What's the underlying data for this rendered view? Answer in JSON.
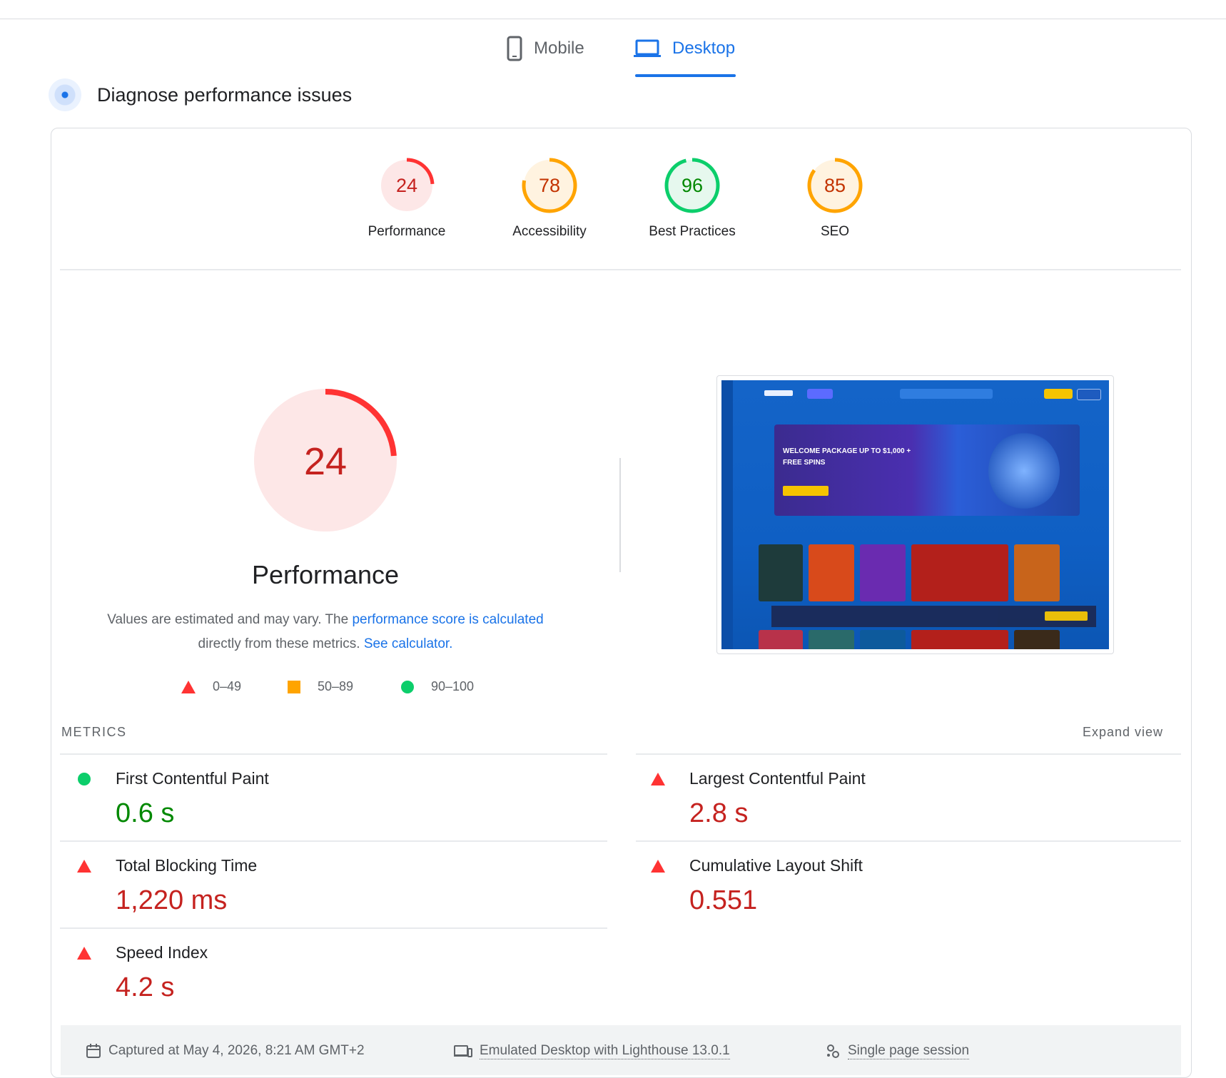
{
  "tabs": {
    "mobile": "Mobile",
    "desktop": "Desktop"
  },
  "diagnose_title": "Diagnose performance issues",
  "scores": [
    {
      "label": "Performance",
      "value": "24",
      "score": 24,
      "status": "fail",
      "color": "#ff3333",
      "bg": "#fde7e7",
      "text_color": "#c5221f"
    },
    {
      "label": "Accessibility",
      "value": "78",
      "score": 78,
      "status": "average",
      "color": "#ffa400",
      "bg": "#fff3e0",
      "text_color": "#c33300"
    },
    {
      "label": "Best Practices",
      "value": "96",
      "score": 96,
      "status": "pass",
      "color": "#0cce6b",
      "bg": "#e6f8ee",
      "text_color": "#008800"
    },
    {
      "label": "SEO",
      "value": "85",
      "score": 85,
      "status": "average",
      "color": "#ffa400",
      "bg": "#fff3e0",
      "text_color": "#c33300"
    }
  ],
  "performance": {
    "value": "24",
    "score": 24,
    "title": "Performance",
    "desc_prefix": "Values are estimated and may vary. The ",
    "desc_link1": "performance score is calculated",
    "desc_middle": "directly from these metrics. ",
    "desc_link2": "See calculator."
  },
  "legend": [
    {
      "icon": "triangle-red",
      "range": "0–49"
    },
    {
      "icon": "square-orange",
      "range": "50–89"
    },
    {
      "icon": "circle-green",
      "range": "90–100"
    }
  ],
  "thumbnail": {
    "banner_line1": "WELCOME PACKAGE UP TO $1,000 +",
    "banner_line2": "FREE SPINS"
  },
  "metrics": {
    "heading": "METRICS",
    "expand": "Expand view",
    "items": [
      {
        "name": "First Contentful Paint",
        "value": "0.6 s",
        "status": "pass",
        "color": "#008800"
      },
      {
        "name": "Largest Contentful Paint",
        "value": "2.8 s",
        "status": "fail",
        "color": "#c5221f"
      },
      {
        "name": "Total Blocking Time",
        "value": "1,220 ms",
        "status": "fail",
        "color": "#c5221f"
      },
      {
        "name": "Cumulative Layout Shift",
        "value": "0.551",
        "status": "fail",
        "color": "#c5221f"
      },
      {
        "name": "Speed Index",
        "value": "4.2 s",
        "status": "fail",
        "color": "#c5221f"
      }
    ]
  },
  "footer": {
    "captured": "Captured at May 4, 2026, 8:21 AM GMT+2",
    "emulated": "Emulated Desktop with Lighthouse 13.0.1",
    "session": "Single page session"
  }
}
